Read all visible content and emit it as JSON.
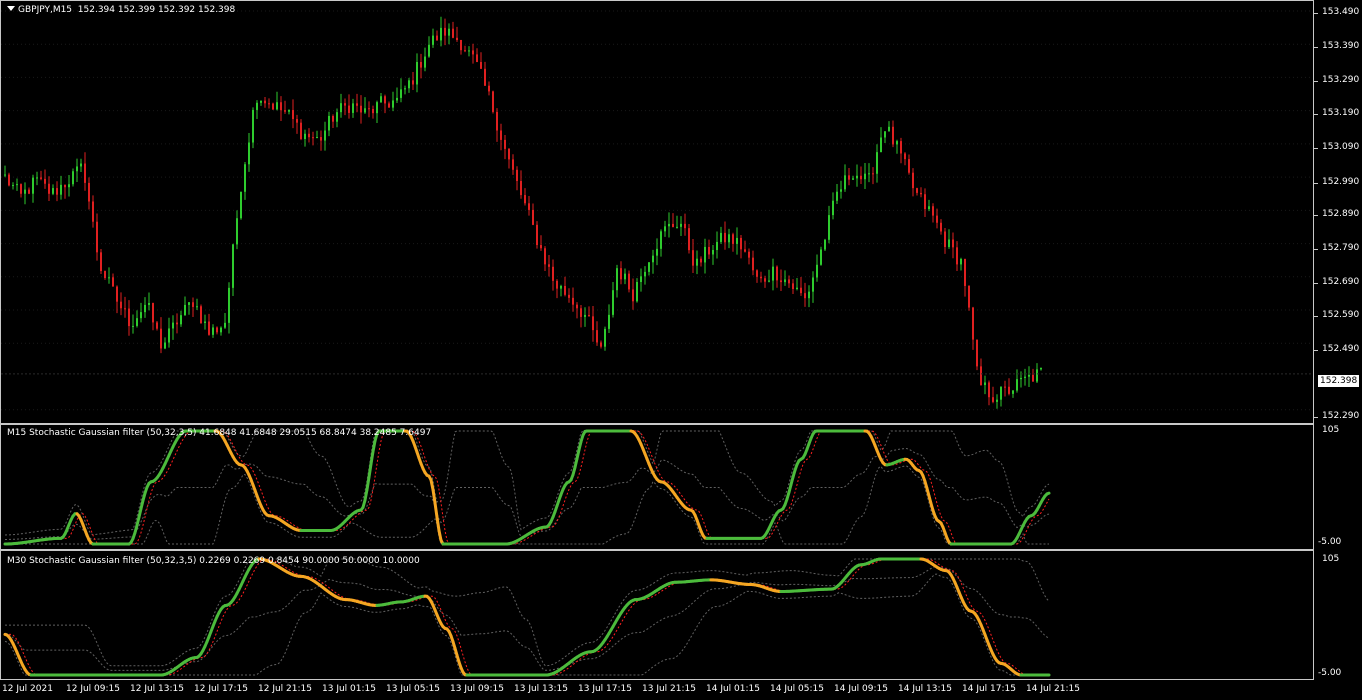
{
  "main_header": {
    "symbol": "GBPJPY,M15",
    "ohlc": "152.394 152.399 152.392 152.398"
  },
  "price_axis": [
    "153.490",
    "153.390",
    "153.290",
    "153.190",
    "153.090",
    "152.990",
    "152.890",
    "152.790",
    "152.690",
    "152.590",
    "152.490",
    "152.398",
    "152.290"
  ],
  "current_price": "152.398",
  "ind1": {
    "title": "M15 Stochastic Gaussian filter (50,32,3,5) 41.6848 41.6848 29.0515 68.8474 38.2485 7.6497",
    "top": "105",
    "bottom": "-5.00"
  },
  "ind2": {
    "title": "M30 Stochastic Gaussian filter (50,32,3,5) 0.2269 0.2269 0.8454 90.0000 50.0000 10.0000",
    "top": "105",
    "bottom": "-5.00"
  },
  "time_axis": [
    "12 Jul 2021",
    "12 Jul 09:15",
    "12 Jul 13:15",
    "12 Jul 17:15",
    "12 Jul 21:15",
    "13 Jul 01:15",
    "13 Jul 05:15",
    "13 Jul 09:15",
    "13 Jul 13:15",
    "13 Jul 17:15",
    "13 Jul 21:15",
    "14 Jul 01:15",
    "14 Jul 05:15",
    "14 Jul 09:15",
    "14 Jul 13:15",
    "14 Jul 17:15",
    "14 Jul 21:15"
  ],
  "colors": {
    "bull": "#2ecc2e",
    "bear": "#e02020",
    "osc_up": "#4cbb3c",
    "osc_down": "#f5a623",
    "signal": "#ff2020",
    "band": "#606060"
  },
  "chart_data": {
    "type": "candlestick",
    "series": "GBPJPY M15",
    "ylim": [
      152.25,
      153.52
    ],
    "close_path": [
      152.99,
      152.93,
      152.98,
      152.94,
      152.98,
      153.02,
      152.73,
      152.63,
      152.55,
      152.61,
      152.48,
      152.56,
      152.62,
      152.52,
      152.55,
      152.96,
      153.24,
      153.21,
      153.18,
      153.12,
      153.1,
      153.18,
      153.21,
      153.18,
      153.21,
      153.22,
      153.29,
      153.39,
      153.43,
      153.4,
      153.33,
      153.21,
      153.05,
      152.92,
      152.79,
      152.67,
      152.63,
      152.57,
      152.46,
      152.72,
      152.64,
      152.75,
      152.83,
      152.86,
      152.72,
      152.78,
      152.81,
      152.78,
      152.67,
      152.71,
      152.67,
      152.62,
      152.77,
      152.94,
      153.01,
      152.97,
      153.15,
      153.06,
      152.94,
      152.88,
      152.79,
      152.73,
      152.37,
      152.33,
      152.35,
      152.38,
      152.4
    ]
  }
}
